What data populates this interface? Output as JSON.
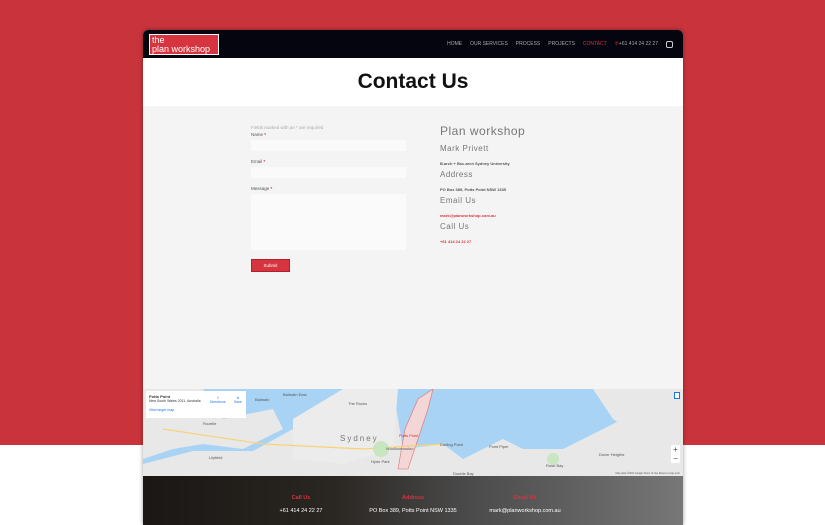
{
  "header": {
    "logo": [
      "the",
      "plan workshop"
    ],
    "nav": [
      "HOME",
      "OUR SERVICES",
      "PROCESS",
      "PROJECTS",
      "CONTACT"
    ],
    "phone": "+61 414 24 22 27",
    "active": "CONTACT"
  },
  "page_title": "Contact Us",
  "form": {
    "note": "Fields marked with an * are required",
    "name_label": "Name",
    "email_label": "Email",
    "message_label": "Message",
    "required": "*",
    "submit": "Submit"
  },
  "info": {
    "company": "Plan workshop",
    "person": "Mark Privett",
    "credentials": "B.arch + Bsc.arch Sydney University",
    "address_h": "Address",
    "address": "PO Box 389, Potts Point NSW 1335",
    "email_h": "Email Us",
    "email": "mark@planworkshop.com.au",
    "call_h": "Call Us",
    "phone": "+61 414 24 22 27"
  },
  "map": {
    "place": "Potts Point",
    "region": "New South Wales 2011, Australia",
    "larger": "View larger map",
    "directions": "Directions",
    "save": "Save",
    "labels": [
      "Balmain",
      "Balmain East",
      "The Rocks",
      "Sydney",
      "Potts Point",
      "Darling Point",
      "Point Piper",
      "Rozelle",
      "Lilyfield",
      "Hyde Park",
      "Double Bay",
      "Rose Bay",
      "Dover Heights",
      "Woolloomooloo"
    ],
    "attribution": "Map data ©2019 Google  Terms of Use  Report a map error"
  },
  "footer": [
    {
      "h": "Call Us",
      "v": "+61 414 24 22 27"
    },
    {
      "h": "Address",
      "v": "PO Box 389, Potts Point NSW 1335"
    },
    {
      "h": "Email Us",
      "v": "mark@planworkshop.com.au"
    }
  ]
}
